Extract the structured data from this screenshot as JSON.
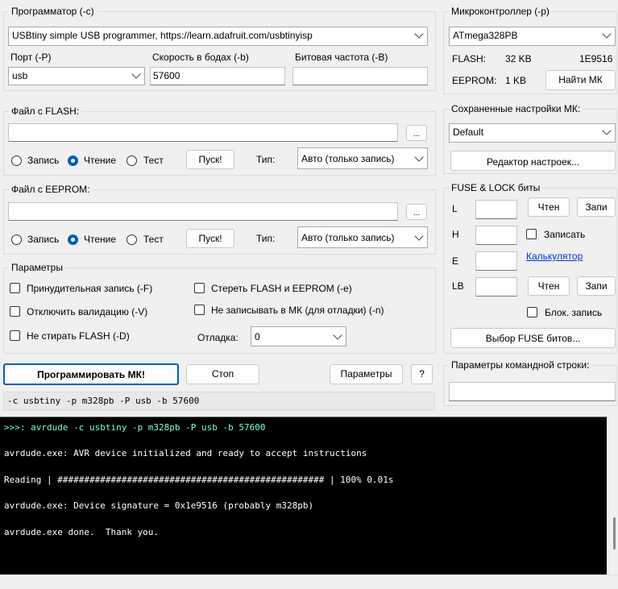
{
  "programmer": {
    "legend": "Программатор (-c)",
    "selected": "USBtiny simple USB programmer, https://learn.adafruit.com/usbtinyisp",
    "port_label": "Порт (-P)",
    "port_value": "usb",
    "baud_label": "Скорость в бодах (-b)",
    "baud_value": "57600",
    "bitclock_label": "Битовая частота (-B)",
    "bitclock_value": ""
  },
  "mcu": {
    "legend": "Микроконтроллер (-p)",
    "selected": "ATmega328PB",
    "flash_label": "FLASH:",
    "flash_size": "32 KB",
    "signature": "1E9516",
    "eeprom_label": "EEPROM:",
    "eeprom_size": "1 KB",
    "find_button": "Найти МК"
  },
  "flash": {
    "legend": "Файл с FLASH:",
    "path": "",
    "browse": "...",
    "write": "Запись",
    "read": "Чтение",
    "test": "Тест",
    "go": "Пуск!",
    "type_label": "Тип:",
    "type_value": "Авто (только запись)"
  },
  "eeprom": {
    "legend": "Файл с EEPROM:",
    "path": "",
    "browse": "...",
    "write": "Запись",
    "read": "Чтение",
    "test": "Тест",
    "go": "Пуск!",
    "type_label": "Тип:",
    "type_value": "Авто (только запись)"
  },
  "saved": {
    "legend": "Сохраненные настройки МК:",
    "selected": "Default",
    "editor_button": "Редактор настроек..."
  },
  "fuse": {
    "legend": "FUSE & LOCK биты",
    "l_label": "L",
    "h_label": "H",
    "e_label": "E",
    "lb_label": "LB",
    "read_button": "Чтен",
    "write_button": "Запи",
    "write_check": "Записать",
    "calculator": "Калькулятор",
    "read_button_lb": "Чтен",
    "write_button_lb": "Запи",
    "lock_write": "Блок. запись",
    "select_button": "Выбор FUSE битов..."
  },
  "params": {
    "legend": "Параметры",
    "force": "Принудительная запись (-F)",
    "erase": "Стереть FLASH и EEPROM (-e)",
    "noverify": "Отключить валидацию (-V)",
    "nowrite": "Не записывать в МК (для отладки) (-n)",
    "noerase": "Не стирать FLASH (-D)",
    "debug_label": "Отладка:",
    "debug_value": "0"
  },
  "actions": {
    "program": "Программировать МК!",
    "stop": "Стоп",
    "settings": "Параметры",
    "help": "?"
  },
  "cmdline": {
    "text": "-c usbtiny -p m328pb -P usb -b 57600",
    "params_label": "Параметры командной строки:",
    "params_value": ""
  },
  "console": {
    "lines": [
      ">>>: avrdude -c usbtiny -p m328pb -P usb -b 57600",
      "avrdude.exe: AVR device initialized and ready to accept instructions",
      "Reading | ################################################## | 100% 0.01s",
      "avrdude.exe: Device signature = 0x1e9516 (probably m328pb)",
      "avrdude.exe done.  Thank you."
    ],
    "prompt_color": "#7fffd4"
  }
}
